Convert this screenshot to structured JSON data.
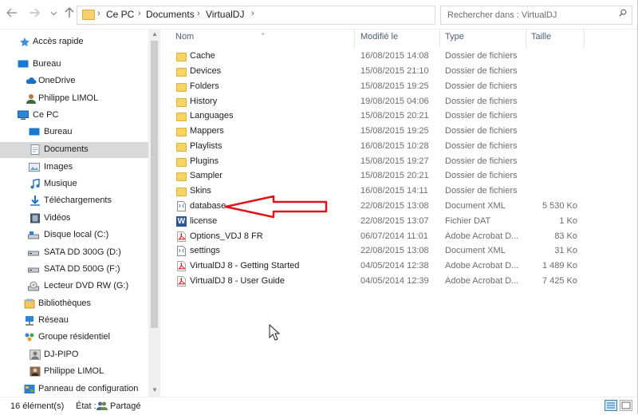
{
  "address_bar": {
    "crumbs": [
      "Ce PC",
      "Documents",
      "VirtualDJ"
    ],
    "search_placeholder": "Rechercher dans : VirtualDJ"
  },
  "sidebar": {
    "items": [
      {
        "label": "Accès rapide",
        "icon": "star-icon"
      },
      {
        "label": "Bureau",
        "icon": "desktop-icon"
      },
      {
        "label": "OneDrive",
        "icon": "cloud-icon"
      },
      {
        "label": "Philippe LIMOL",
        "icon": "user-icon"
      },
      {
        "label": "Ce PC",
        "icon": "computer-icon"
      },
      {
        "label": "Bureau",
        "icon": "desktop-icon"
      },
      {
        "label": "Documents",
        "icon": "documents-icon",
        "selected": true
      },
      {
        "label": "Images",
        "icon": "images-icon"
      },
      {
        "label": "Musique",
        "icon": "music-icon"
      },
      {
        "label": "Téléchargements",
        "icon": "download-icon"
      },
      {
        "label": "Vidéos",
        "icon": "video-icon"
      },
      {
        "label": "Disque local (C:)",
        "icon": "drive-icon"
      },
      {
        "label": "SATA DD 300G (D:)",
        "icon": "drive-icon"
      },
      {
        "label": "SATA DD 500G (F:)",
        "icon": "drive-icon"
      },
      {
        "label": "Lecteur DVD RW (G:)",
        "icon": "dvd-icon"
      },
      {
        "label": "Bibliothèques",
        "icon": "library-icon"
      },
      {
        "label": "Réseau",
        "icon": "network-icon"
      },
      {
        "label": "Groupe résidentiel",
        "icon": "homegroup-icon"
      },
      {
        "label": "DJ-PIPO",
        "icon": "user-icon"
      },
      {
        "label": "Philippe LIMOL",
        "icon": "user-icon"
      },
      {
        "label": "Panneau de configuration",
        "icon": "control-panel-icon"
      }
    ]
  },
  "columns": {
    "name": "Nom",
    "modified": "Modifié le",
    "type": "Type",
    "size": "Taille"
  },
  "files": [
    {
      "name": "Cache",
      "modified": "16/08/2015 14:08",
      "type": "Dossier de fichiers",
      "size": "",
      "icon": "folder-icon"
    },
    {
      "name": "Devices",
      "modified": "15/08/2015 21:10",
      "type": "Dossier de fichiers",
      "size": "",
      "icon": "folder-icon"
    },
    {
      "name": "Folders",
      "modified": "15/08/2015 19:25",
      "type": "Dossier de fichiers",
      "size": "",
      "icon": "folder-icon"
    },
    {
      "name": "History",
      "modified": "19/08/2015 04:06",
      "type": "Dossier de fichiers",
      "size": "",
      "icon": "folder-icon"
    },
    {
      "name": "Languages",
      "modified": "15/08/2015 20:21",
      "type": "Dossier de fichiers",
      "size": "",
      "icon": "folder-icon"
    },
    {
      "name": "Mappers",
      "modified": "15/08/2015 19:25",
      "type": "Dossier de fichiers",
      "size": "",
      "icon": "folder-icon"
    },
    {
      "name": "Playlists",
      "modified": "16/08/2015 10:28",
      "type": "Dossier de fichiers",
      "size": "",
      "icon": "folder-icon"
    },
    {
      "name": "Plugins",
      "modified": "15/08/2015 19:27",
      "type": "Dossier de fichiers",
      "size": "",
      "icon": "folder-icon"
    },
    {
      "name": "Sampler",
      "modified": "15/08/2015 20:21",
      "type": "Dossier de fichiers",
      "size": "",
      "icon": "folder-icon"
    },
    {
      "name": "Skins",
      "modified": "16/08/2015 14:11",
      "type": "Dossier de fichiers",
      "size": "",
      "icon": "folder-icon"
    },
    {
      "name": "database",
      "modified": "22/08/2015 13:08",
      "type": "Document XML",
      "size": "5 530 Ko",
      "icon": "xml-file-icon"
    },
    {
      "name": "license",
      "modified": "22/08/2015 13:07",
      "type": "Fichier DAT",
      "size": "1 Ko",
      "icon": "word-file-icon"
    },
    {
      "name": "Options_VDJ 8 FR",
      "modified": "06/07/2014 11:01",
      "type": "Adobe Acrobat D...",
      "size": "83 Ko",
      "icon": "pdf-file-icon"
    },
    {
      "name": "settings",
      "modified": "22/08/2015 13:08",
      "type": "Document XML",
      "size": "31 Ko",
      "icon": "xml-file-icon"
    },
    {
      "name": "VirtualDJ 8 - Getting Started",
      "modified": "04/05/2014 12:38",
      "type": "Adobe Acrobat D...",
      "size": "1 489 Ko",
      "icon": "pdf-file-icon"
    },
    {
      "name": "VirtualDJ 8 - User Guide",
      "modified": "04/05/2014 12:39",
      "type": "Adobe Acrobat D...",
      "size": "7 425 Ko",
      "icon": "pdf-file-icon"
    }
  ],
  "status": {
    "count": "16 élément(s)",
    "state_label": "État :",
    "state_value": "Partagé"
  },
  "colors": {
    "annotation_arrow": "#e0141b",
    "selected_bg": "#d9d9d9",
    "header_text": "#4c607a"
  }
}
